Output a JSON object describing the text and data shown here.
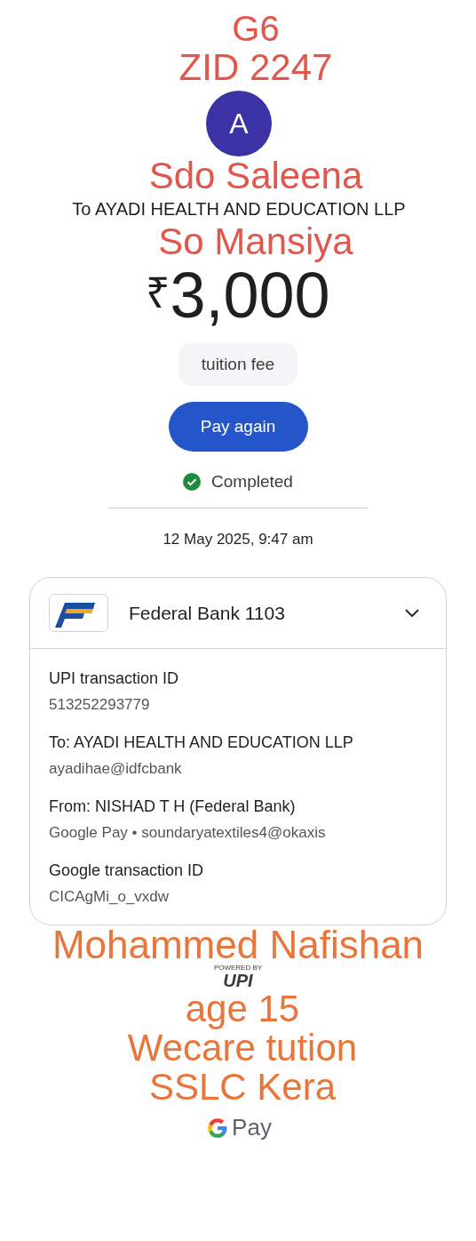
{
  "annotations": [
    {
      "text": "G6",
      "color": "#e2574c"
    },
    {
      "text": "ZID 2247",
      "color": "#e2574c"
    },
    {
      "text": "Sdo Saleena",
      "color": "#e2574c"
    },
    {
      "text": "So Mansiya",
      "color": "#e2574c"
    },
    {
      "text": "Mohammed Nafishan",
      "color": "#e8763a"
    },
    {
      "text": "age 15",
      "color": "#e8763a"
    },
    {
      "text": "Wecare tution",
      "color": "#e8763a"
    },
    {
      "text": "SSLC Kera",
      "color": "#e8763a"
    }
  ],
  "avatar": {
    "initial": "A"
  },
  "recipient": "To AYADI HEALTH AND EDUCATION LLP",
  "amount": {
    "currency": "₹",
    "value": "3,000"
  },
  "note": "tuition fee",
  "pay_again": "Pay again",
  "status": {
    "label": "Completed",
    "completed": true
  },
  "datetime": "12 May 2025, 9:47 am",
  "account": {
    "bank": "Federal Bank 1103",
    "expanded": true
  },
  "details": [
    {
      "label": "UPI transaction ID",
      "value": "513252293779"
    },
    {
      "label": "To: AYADI HEALTH AND EDUCATION LLP",
      "value": "ayadihae@idfcbank"
    },
    {
      "label": "From: NISHAD T H (Federal Bank)",
      "value": "Google Pay • soundaryatextiles4@okaxis"
    },
    {
      "label": "Google transaction ID",
      "value": "CICAgMi_o_vxdw"
    }
  ],
  "footer": {
    "upi_caption": "POWERED BY",
    "upi_logo": "UPI",
    "brand": "Pay"
  }
}
